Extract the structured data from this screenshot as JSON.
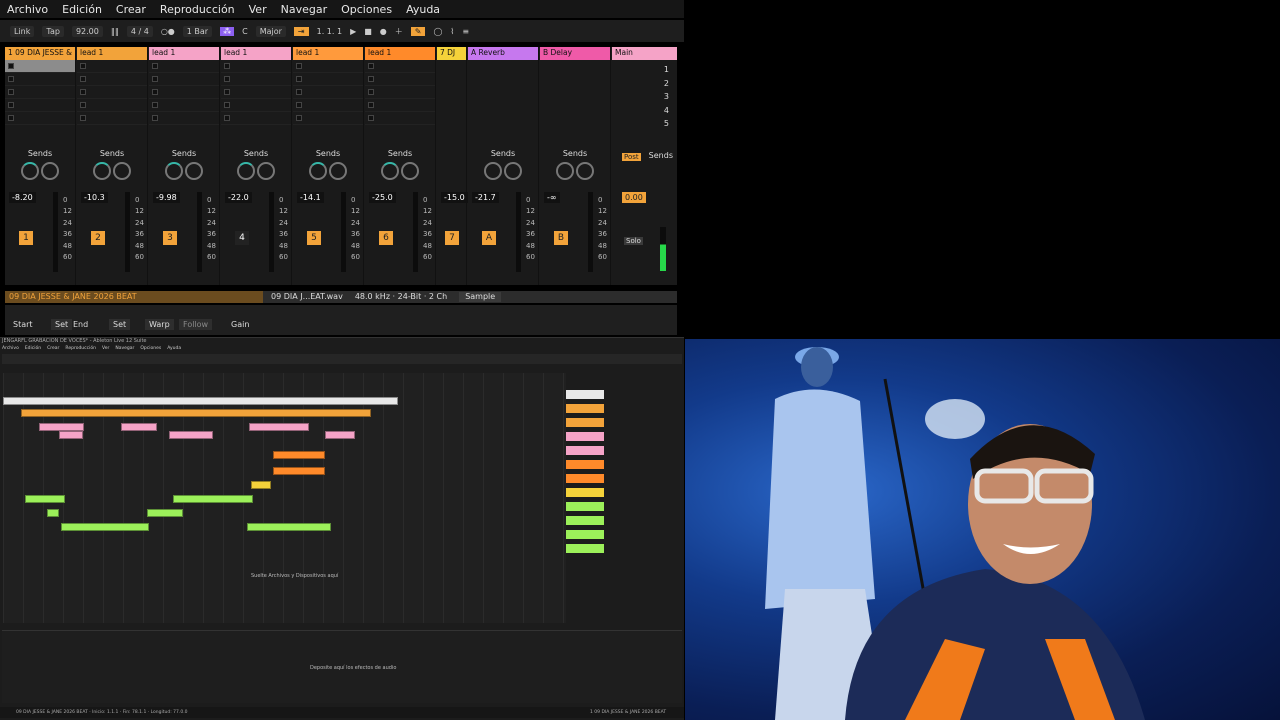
{
  "menu": [
    "Archivo",
    "Edición",
    "Crear",
    "Reproducción",
    "Ver",
    "Navegar",
    "Opciones",
    "Ayuda"
  ],
  "transport": {
    "link": "Link",
    "tap": "Tap",
    "tempo": "92.00",
    "signature": "4 / 4",
    "bar": "1 Bar",
    "key_letter": "C",
    "scale": "Major",
    "position": "1.  1.  1"
  },
  "tracks": [
    {
      "title": "1 09 DIA JESSE &",
      "vol": "-8.20",
      "num": "1",
      "color": "#f2a33a"
    },
    {
      "title": "lead 1",
      "vol": "-10.3",
      "num": "2",
      "color": "#f2a33a"
    },
    {
      "title": "lead 1",
      "vol": "-9.98",
      "num": "3",
      "color": "#f5a3c7"
    },
    {
      "title": "lead 1",
      "vol": "-22.0",
      "num": "4",
      "color": "#f5a3c7"
    },
    {
      "title": "lead 1",
      "vol": "-14.1",
      "num": "5",
      "color": "#ff9a3c"
    },
    {
      "title": "lead 1",
      "vol": "-25.0",
      "num": "6",
      "color": "#ff8a2a"
    },
    {
      "title": "7 DJ",
      "vol": "-15.0",
      "num": "7",
      "color": "#f5d23a"
    },
    {
      "title": "A Reverb",
      "vol": "-21.7",
      "num": "A",
      "color": "#c678ee"
    },
    {
      "title": "B Delay",
      "vol": "-∞",
      "num": "B",
      "color": "#ef5aa8"
    }
  ],
  "main": {
    "title": "Main",
    "vol": "0.00",
    "post": "Post",
    "solo": "Solo",
    "scenes": [
      "1",
      "2",
      "3",
      "4",
      "5"
    ]
  },
  "sends_label": "Sends",
  "knob_a": "A",
  "knob_b": "B",
  "meter_scale": [
    "0",
    "12",
    "24",
    "36",
    "48",
    "60"
  ],
  "clip": {
    "name": "09 DIA JESSE & JANE 2026 BEAT",
    "file": "09 DIA J...EAT.wav",
    "info": "48.0 kHz · 24-Bit · 2 Ch",
    "sample": "Sample"
  },
  "clipctl": {
    "start": "Start",
    "set1": "Set",
    "end": "End",
    "set2": "Set",
    "warp": "Warp",
    "follow": "Follow",
    "gain": "Gain"
  },
  "arrangement": {
    "title": "JENGARFL GRABACION DE VOCES* - Ableton Live 12 Suite",
    "menu": [
      "Archivo",
      "Edición",
      "Crear",
      "Reproducción",
      "Ver",
      "Navegar",
      "Opciones",
      "Ayuda"
    ],
    "drop_hint": "Suelte Archivos y Dispositivos aquí",
    "device_hint": "Deposite aquí los efectos de audio",
    "status": "09 DIA JESSE & JANE 2026 BEAT · Inicio: 1.1.1 · Fin: 78.1.1 · Longitud: 77.0.0",
    "status_clip": "1 09 DIA JESSE & JANE 2026 BEAT"
  }
}
